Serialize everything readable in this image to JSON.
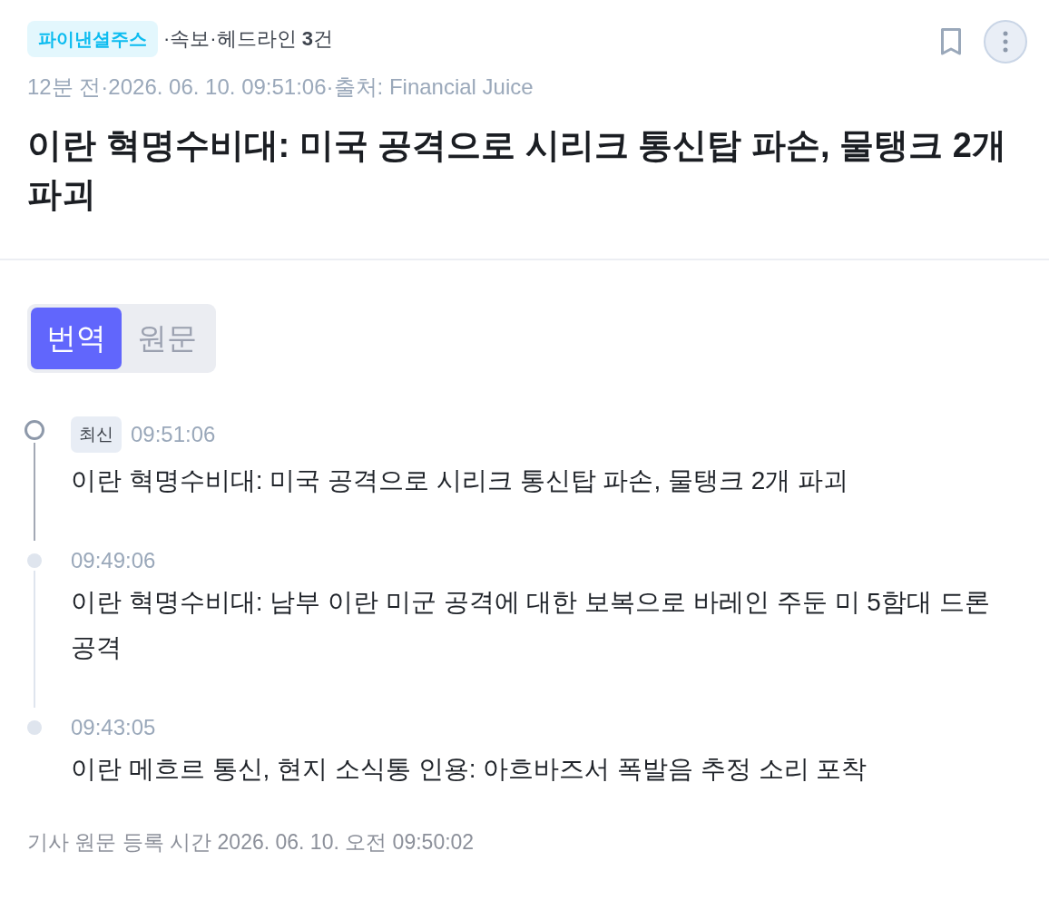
{
  "header": {
    "source": "파이낸셜주스",
    "meta": "·속보·헤드라인 **3**건",
    "info": "12분 전·2026. 06. 10. 09:51:06·출처: Financial Juice",
    "title": "이란 혁명수비대: 미국 공격으로 시리크 통신탑 파손, 물탱크 2개 파괴",
    "bookmarked": false
  },
  "tabs": [
    {
      "label": "번역",
      "selected": true
    },
    {
      "label": "원문",
      "selected": false
    }
  ],
  "timeline": [
    {
      "latest": true,
      "badge": "최신",
      "time": "09:51:06",
      "text": "이란 혁명수비대: 미국 공격으로 시리크 통신탑 파손, 물탱크 2개 파괴"
    },
    {
      "latest": false,
      "time": "09:49:06",
      "text": "이란 혁명수비대: 남부 이란 미군 공격에 대한 보복으로 바레인 주둔 미 5함대 드론 공격"
    },
    {
      "latest": false,
      "time": "09:43:05",
      "text": "이란 메흐르 통신, 현지 소식통 인용: 아흐바즈서 폭발음 추정 소리 포착"
    }
  ],
  "footer": "기사 원문 등록 시간 2026. 06. 10. 오전 09:50:02"
}
